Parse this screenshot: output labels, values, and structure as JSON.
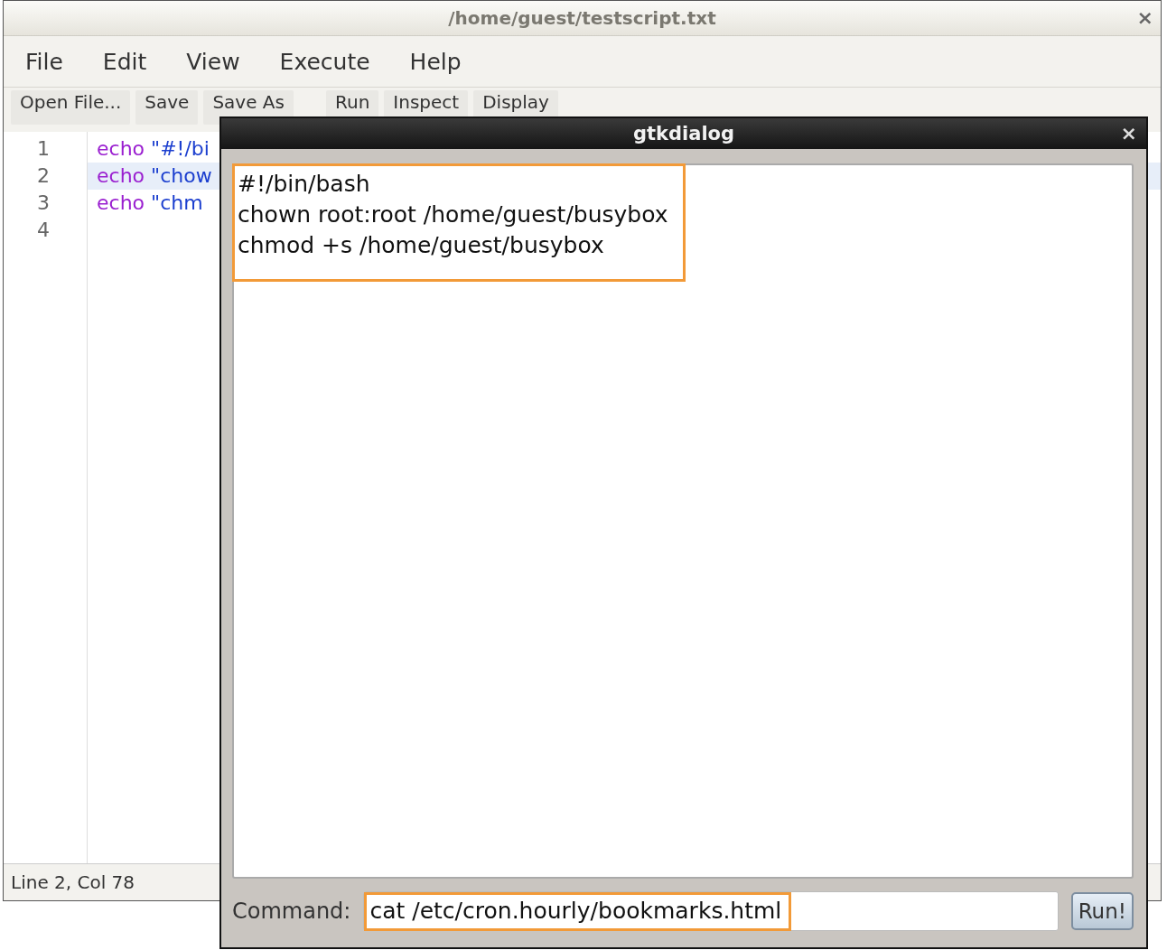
{
  "window": {
    "title": "/home/guest/testscript.txt",
    "close": "×"
  },
  "menu": [
    {
      "label": "File"
    },
    {
      "label": "Edit"
    },
    {
      "label": "View"
    },
    {
      "label": "Execute"
    },
    {
      "label": "Help"
    }
  ],
  "toolbar": [
    {
      "label": "Open File..."
    },
    {
      "label": "Save"
    },
    {
      "label": "Save As"
    },
    {
      "label": "Run"
    },
    {
      "label": "Inspect"
    },
    {
      "label": "Display"
    }
  ],
  "editor": {
    "lines": [
      {
        "number": "1",
        "keyword": "echo",
        "text": "\"#!/bi",
        "current": false
      },
      {
        "number": "2",
        "keyword": "echo",
        "text": "\"chow",
        "current": true
      },
      {
        "number": "3",
        "keyword": "echo",
        "text": "\"chm",
        "current": false
      },
      {
        "number": "4",
        "current": false
      }
    ]
  },
  "status_bar": "Line 2, Col 78",
  "dialog": {
    "title": "gtkdialog",
    "close": "×",
    "output": [
      "#!/bin/bash",
      "chown root:root /home/guest/busybox",
      "chmod +s /home/guest/busybox"
    ],
    "command_label": "Command:",
    "command_value": "cat /etc/cron.hourly/bookmarks.html",
    "run_button": "Run!"
  }
}
